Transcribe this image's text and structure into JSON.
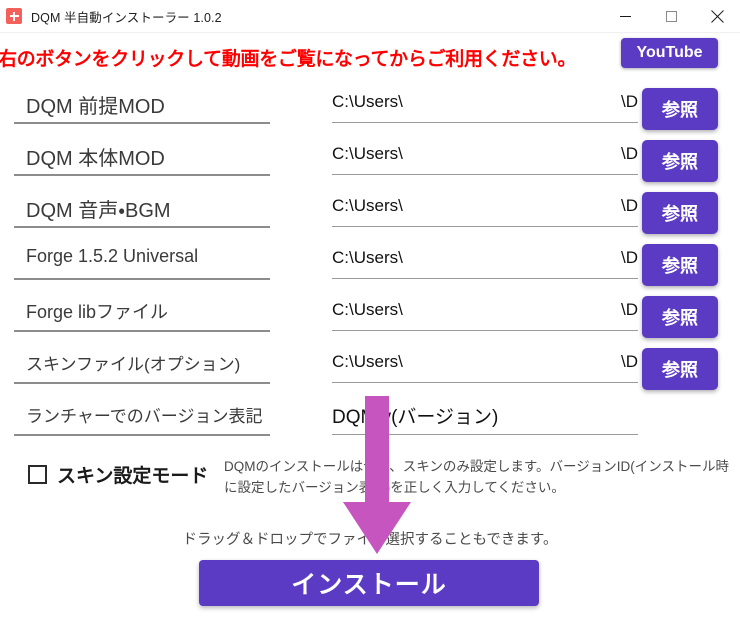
{
  "window": {
    "title": "DQM 半自動インストーラー 1.0.2",
    "icon": "app-icon",
    "minimize_label": "minimize-icon",
    "maximize_label": "maximize-icon",
    "close_label": "close-icon"
  },
  "header": {
    "notice": "右のボタンをクリックして動画をご覧になってからご利用ください。",
    "youtube_label": "YouTube"
  },
  "colors": {
    "accent_purple": "#5b3bc4",
    "notice_red": "#ff0000",
    "arrow_magenta": "#c655c0",
    "app_icon_red": "#f4605a",
    "underline_gray": "#8c8c8c"
  },
  "fields": [
    {
      "label": "DQM 前提MOD",
      "value_left": "C:\\Users\\",
      "value_right": "\\D",
      "browse_label": "参照",
      "has_browse": true
    },
    {
      "label": "DQM 本体MOD",
      "value_left": "C:\\Users\\",
      "value_right": "\\D",
      "browse_label": "参照",
      "has_browse": true
    },
    {
      "label": "DQM 音声・BGM",
      "value_left": "C:\\Users\\",
      "value_right": "\\D",
      "browse_label": "参照",
      "has_browse": true
    },
    {
      "label": "Forge 1.5.2 Universal",
      "value_left": "C:\\Users\\",
      "value_right": "\\D",
      "browse_label": "参照",
      "has_browse": true
    },
    {
      "label": "Forge libファイル",
      "value_left": "C:\\Users\\",
      "value_right": "\\D",
      "browse_label": "参照",
      "has_browse": true
    },
    {
      "label": "スキンファイル(オプション)",
      "value_left": "C:\\Users\\",
      "value_right": "\\D",
      "browse_label": "参照",
      "has_browse": true
    },
    {
      "label": "ランチャーでのバージョン表記",
      "value_left": "DQM  v(バージョン)",
      "value_right": "",
      "browse_label": "",
      "has_browse": false
    }
  ],
  "skin_mode": {
    "label": "スキン設定モード",
    "checked": false,
    "description": "DQMのインストールはせず、スキンのみ設定します。バージョンID(インストール時に設定したバージョン表記)を正しく入力してください。"
  },
  "footer": {
    "dnd_hint": "ドラッグ＆ドロップでファイル選択することもできます。",
    "install_label": "インストール"
  },
  "annotation": {
    "arrow": "down-arrow-icon"
  }
}
